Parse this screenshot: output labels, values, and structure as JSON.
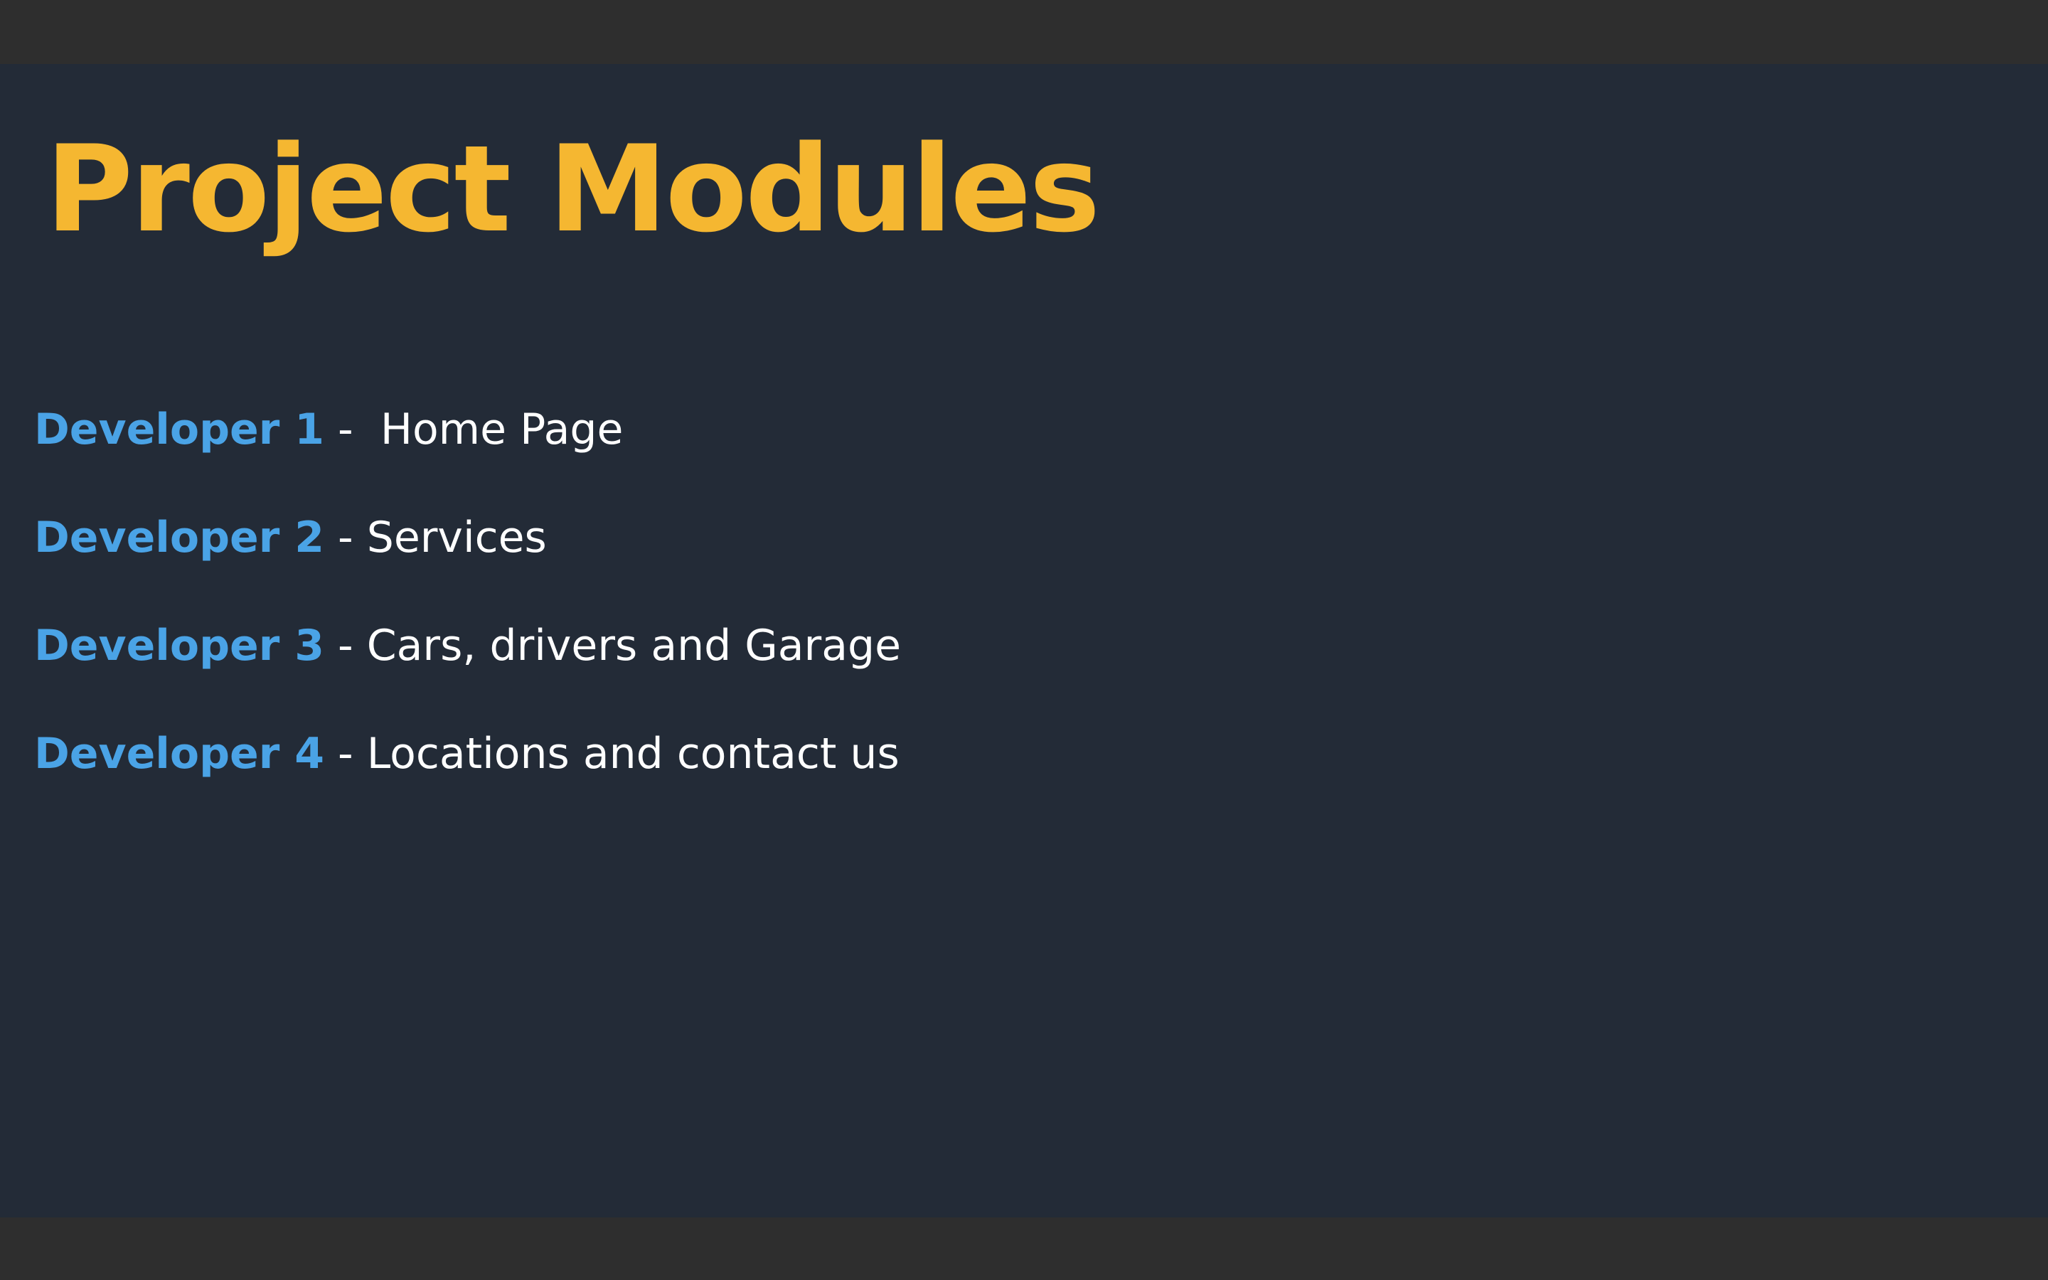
{
  "slide": {
    "title": "Project Modules",
    "title_color": "#f5b731",
    "developer_color": "#4aa3e6",
    "text_color": "#ffffff",
    "background_color": "#232b37",
    "modules": [
      {
        "developer": "Developer 1",
        "separator": " -  ",
        "description": "Home Page"
      },
      {
        "developer": "Developer 2",
        "separator": " - ",
        "description": "Services"
      },
      {
        "developer": "Developer 3",
        "separator": " - ",
        "description": "Cars, drivers and Garage"
      },
      {
        "developer": "Developer 4",
        "separator": " - ",
        "description": "Locations and contact us"
      }
    ]
  }
}
